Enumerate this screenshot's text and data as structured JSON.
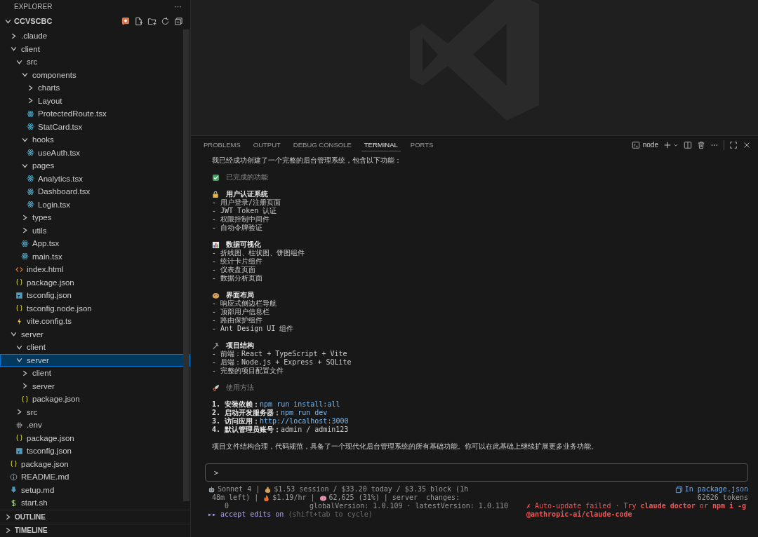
{
  "explorer": {
    "title": "EXPLORER",
    "more": "···",
    "root": {
      "name": "CCVSCBC",
      "expanded": true
    },
    "tree": [
      {
        "name": ".claude",
        "kind": "folder",
        "expanded": false,
        "selected": false
      },
      {
        "name": "client",
        "kind": "folder",
        "expanded": true,
        "selected": false,
        "children": [
          {
            "name": "src",
            "kind": "folder",
            "expanded": true,
            "selected": false,
            "children": [
              {
                "name": "components",
                "kind": "folder",
                "expanded": true,
                "selected": false,
                "children": [
                  {
                    "name": "charts",
                    "kind": "folder",
                    "expanded": false,
                    "selected": false
                  },
                  {
                    "name": "Layout",
                    "kind": "folder",
                    "expanded": false,
                    "selected": false
                  },
                  {
                    "name": "ProtectedRoute.tsx",
                    "kind": "react",
                    "selected": false
                  },
                  {
                    "name": "StatCard.tsx",
                    "kind": "react",
                    "selected": false
                  }
                ]
              },
              {
                "name": "hooks",
                "kind": "folder",
                "expanded": true,
                "selected": false,
                "children": [
                  {
                    "name": "useAuth.tsx",
                    "kind": "react",
                    "selected": false
                  }
                ]
              },
              {
                "name": "pages",
                "kind": "folder",
                "expanded": true,
                "selected": false,
                "children": [
                  {
                    "name": "Analytics.tsx",
                    "kind": "react",
                    "selected": false
                  },
                  {
                    "name": "Dashboard.tsx",
                    "kind": "react",
                    "selected": false
                  },
                  {
                    "name": "Login.tsx",
                    "kind": "react",
                    "selected": false
                  }
                ]
              },
              {
                "name": "types",
                "kind": "folder",
                "expanded": false,
                "selected": false
              },
              {
                "name": "utils",
                "kind": "folder",
                "expanded": false,
                "selected": false
              },
              {
                "name": "App.tsx",
                "kind": "react",
                "selected": false
              },
              {
                "name": "main.tsx",
                "kind": "react",
                "selected": false
              }
            ]
          },
          {
            "name": "index.html",
            "kind": "html",
            "selected": false
          },
          {
            "name": "package.json",
            "kind": "json",
            "selected": false
          },
          {
            "name": "tsconfig.json",
            "kind": "ts",
            "selected": false
          },
          {
            "name": "tsconfig.node.json",
            "kind": "json",
            "selected": false
          },
          {
            "name": "vite.config.ts",
            "kind": "bolt",
            "selected": false
          }
        ]
      },
      {
        "name": "server",
        "kind": "folder",
        "expanded": true,
        "selected": false,
        "children": [
          {
            "name": "client",
            "kind": "folder",
            "expanded": true,
            "selected": false
          },
          {
            "name": "server",
            "kind": "folder",
            "expanded": true,
            "selected": true,
            "children": [
              {
                "name": "client",
                "kind": "folder",
                "expanded": false,
                "selected": false
              },
              {
                "name": "server",
                "kind": "folder",
                "expanded": false,
                "selected": false
              },
              {
                "name": "package.json",
                "kind": "json",
                "selected": false
              }
            ]
          },
          {
            "name": "src",
            "kind": "folder",
            "expanded": false,
            "selected": false
          },
          {
            "name": ".env",
            "kind": "gear",
            "selected": false
          },
          {
            "name": "package.json",
            "kind": "json",
            "selected": false
          },
          {
            "name": "tsconfig.json",
            "kind": "ts",
            "selected": false
          }
        ]
      },
      {
        "name": "package.json",
        "kind": "json",
        "selected": false
      },
      {
        "name": "README.md",
        "kind": "info",
        "selected": false
      },
      {
        "name": "setup.md",
        "kind": "download",
        "selected": false
      },
      {
        "name": "start.sh",
        "kind": "dollar",
        "selected": false
      }
    ],
    "sections": [
      {
        "label": "OUTLINE",
        "expanded": false
      },
      {
        "label": "TIMELINE",
        "expanded": false
      }
    ]
  },
  "panel": {
    "tabs": [
      {
        "label": "PROBLEMS",
        "selected": false
      },
      {
        "label": "OUTPUT",
        "selected": false
      },
      {
        "label": "DEBUG CONSOLE",
        "selected": false
      },
      {
        "label": "TERMINAL",
        "selected": true
      },
      {
        "label": "PORTS",
        "selected": false
      }
    ],
    "terminal_name": "node"
  },
  "terminal": {
    "lines": [
      {
        "kind": "text",
        "text": "我已经成功创建了一个完整的后台管理系统，包含以下功能："
      },
      {
        "kind": "blank"
      },
      {
        "kind": "check",
        "text": "已完成的功能",
        "muted": true
      },
      {
        "kind": "blank"
      },
      {
        "kind": "lock",
        "text": "用户认证系统",
        "muted": false
      },
      {
        "kind": "text",
        "text": "- 用户登录/注册页面"
      },
      {
        "kind": "text",
        "text": "- JWT Token 认证"
      },
      {
        "kind": "text",
        "text": "- 权限控制中间件"
      },
      {
        "kind": "text",
        "text": "- 自动令牌验证"
      },
      {
        "kind": "blank"
      },
      {
        "kind": "chart",
        "text": "数据可视化",
        "muted": false
      },
      {
        "kind": "text",
        "text": "- 折线图、柱状图、饼图组件"
      },
      {
        "kind": "text",
        "text": "- 统计卡片组件"
      },
      {
        "kind": "text",
        "text": "- 仪表盘页面"
      },
      {
        "kind": "text",
        "text": "- 数据分析页面"
      },
      {
        "kind": "blank"
      },
      {
        "kind": "palette",
        "text": "界面布局",
        "muted": false
      },
      {
        "kind": "text",
        "text": "- 响应式侧边栏导航"
      },
      {
        "kind": "text",
        "text": "- 顶部用户信息栏"
      },
      {
        "kind": "text",
        "text": "- 路由保护组件"
      },
      {
        "kind": "text",
        "text": "- Ant Design UI 组件"
      },
      {
        "kind": "blank"
      },
      {
        "kind": "tools",
        "text": "项目结构",
        "muted": false
      },
      {
        "kind": "text",
        "text": "- 前端：React + TypeScript + Vite"
      },
      {
        "kind": "text",
        "text": "- 后端：Node.js + Express + SQLite"
      },
      {
        "kind": "text",
        "text": "- 完整的项目配置文件"
      },
      {
        "kind": "blank"
      },
      {
        "kind": "rocket",
        "text": "使用方法",
        "muted": true
      },
      {
        "kind": "blank"
      },
      {
        "kind": "step",
        "label": "1. 安装依赖：",
        "value": "npm run install:all",
        "highlight": true
      },
      {
        "kind": "step",
        "label": "2. 启动开发服务器：",
        "value": "npm run dev",
        "highlight": true
      },
      {
        "kind": "step",
        "label": "3. 访问应用：",
        "value": "http://localhost:3000",
        "highlight": true
      },
      {
        "kind": "step",
        "label": "4. 默认管理员账号：",
        "value": "admin / admin123",
        "highlight": false
      },
      {
        "kind": "blank"
      },
      {
        "kind": "text",
        "text": "项目文件结构合理，代码规范，具备了一个现代化后台管理系统的所有基础功能。你可以在此基础上继续扩展更多业务功能。"
      }
    ],
    "prompt": ">",
    "status": {
      "usage_1": [
        "Sonnet 4 | ",
        "$1.53 session / $33.20 today / $3.35 block (1h"
      ],
      "usage_2": [
        " 48m left) | ",
        "$1.19/hr | ",
        "62,625 (31%) | server  changes:"
      ],
      "changes_count": "0",
      "versions": "globalVersion: 1.0.109 · latestVersion: 1.0.110",
      "mode_marker": "▸▸",
      "mode": "accept edits on",
      "mode_hint": "(shift+tab to cycle)",
      "file_context": "In package.json",
      "tokens": "62626 tokens",
      "error": "✗ Auto-update failed · Try **claude doctor** or **npm i -g @anthropic-ai/claude-code**"
    }
  }
}
